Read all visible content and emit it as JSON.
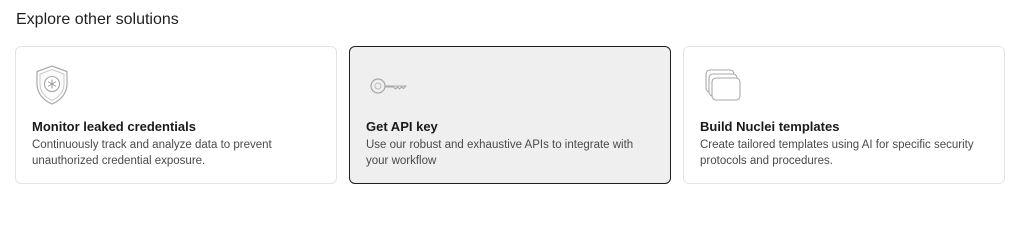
{
  "section": {
    "title": "Explore other solutions"
  },
  "cards": [
    {
      "icon": "shield-icon",
      "title": "Monitor leaked credentials",
      "description": "Continuously track and analyze data to prevent unauthorized credential exposure.",
      "active": false
    },
    {
      "icon": "key-icon",
      "title": "Get API key",
      "description": "Use our robust and exhaustive APIs to integrate with your workflow",
      "active": true
    },
    {
      "icon": "stacked-templates-icon",
      "title": "Build Nuclei templates",
      "description": "Create tailored templates using AI for specific security protocols and procedures.",
      "active": false
    }
  ],
  "colors": {
    "active_border": "#1f1f1f",
    "active_background": "#efefef",
    "card_border": "#e4e4e4",
    "icon_stroke": "#a8a8a8"
  }
}
